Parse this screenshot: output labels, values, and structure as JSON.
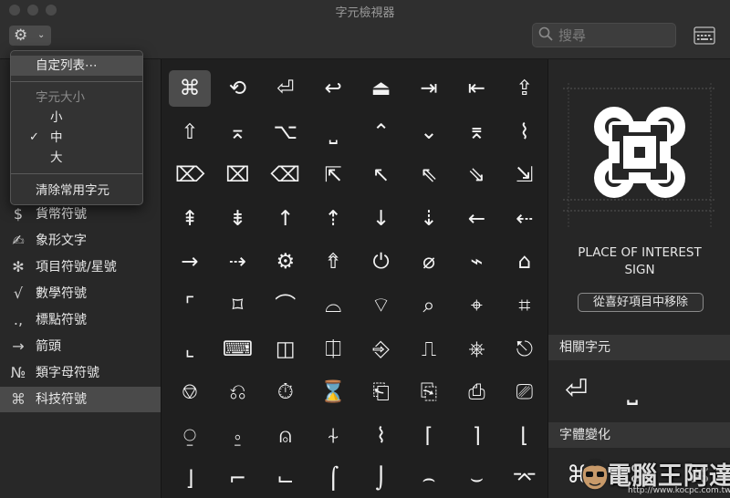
{
  "window": {
    "title": "字元檢視器"
  },
  "toolbar": {
    "gear_icon": "⚙",
    "chevron_icon": "⌄",
    "search_placeholder": "搜尋"
  },
  "menu": {
    "customize_list": "自定列表⋯",
    "size_heading": "字元大小",
    "size_small": "小",
    "size_medium": "中",
    "size_large": "大",
    "checkmark": "✓",
    "clear_frequent": "清除常用字元"
  },
  "sidebar": {
    "items": [
      {
        "icon": "$",
        "label": "貨幣符號"
      },
      {
        "icon": "✍",
        "label": "象形文字"
      },
      {
        "icon": "✻",
        "label": "項目符號/星號"
      },
      {
        "icon": "√",
        "label": "數學符號"
      },
      {
        "icon": ".,",
        "label": "標點符號"
      },
      {
        "icon": "→",
        "label": "箭頭"
      },
      {
        "icon": "№",
        "label": "類字母符號"
      },
      {
        "icon": "⌘",
        "label": "科技符號"
      }
    ]
  },
  "grid": {
    "chars": [
      "⌘",
      "⟲",
      "⏎",
      "↩",
      "⏏",
      "⇥",
      "⇤",
      "⇪",
      "⇧",
      "⌅",
      "⌥",
      "⎵",
      "⌃",
      "⌄",
      "⌆",
      "⌇",
      "⌦",
      "⌧",
      "⌫",
      "⇱",
      "↖",
      "⇖",
      "⇘",
      "⇲",
      "⇞",
      "⇟",
      "↑",
      "⇡",
      "↓",
      "⇣",
      "←",
      "⇠",
      "→",
      "⇢",
      "⚙",
      "⇮",
      "⏻",
      "⌀",
      "⌁",
      "⌂",
      "⌜",
      "⌑",
      "⌒",
      "⌓",
      "⌔",
      "⌕",
      "⌖",
      "⌗",
      "⌞",
      "⌨",
      "◫",
      "⎅",
      "⎆",
      "⎍",
      "⎈",
      "⎋",
      "⎊",
      "⎌",
      "⏱",
      "⌛",
      "⎗",
      "⎘",
      "⎙",
      "⎚",
      "⍜",
      "⍛",
      "⍝",
      "⍭",
      "⌇",
      "⌈",
      "⌉",
      "⌊",
      "⌋",
      "⌐",
      "⌙",
      "⌠",
      "⌡",
      "⌢",
      "⌣",
      "⌤"
    ]
  },
  "detail": {
    "preview_char": "⌘",
    "char_name_line1": "PLACE OF INTEREST",
    "char_name_line2": "SIGN",
    "remove_favorite": "從喜好項目中移除",
    "related_heading": "相關字元",
    "related_chars": [
      "⏎",
      "⎵"
    ],
    "variants_heading": "字體變化",
    "variant_chars": [
      "⌘",
      "⌘",
      "⌘"
    ]
  },
  "watermark": {
    "brand": "電腦王阿達",
    "url": "http://www.kocpc.com.tw"
  },
  "colors": {
    "selected_cell": "#4c4c4c",
    "selected_sidebar": "#4a4a4a",
    "background": "#1f1f1f"
  }
}
